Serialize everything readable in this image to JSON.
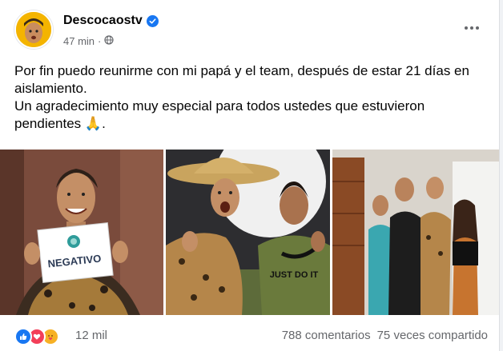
{
  "post": {
    "author": "Descocaostv",
    "time": "47 min",
    "text_lines": [
      "Por fin puedo reunirme con mi papá y el team, después de estar 21 días en aislamiento.",
      "Un agradecimiento muy especial para todos ustedes que estuvieron pendientes"
    ],
    "text_emoji": "🙏",
    "text_end": "."
  },
  "photos": {
    "sign_text": "NEGATIVO",
    "shirt_text": "JUST DO IT"
  },
  "footer": {
    "reaction_count": "12 mil",
    "comments": "788 comentarios",
    "shares": "75 veces compartido"
  },
  "colors": {
    "accent": "#1877f2",
    "like": "#1877f2",
    "love": "#f33e58",
    "care": "#f7b125"
  },
  "icons": [
    "verified-badge-icon",
    "globe-icon",
    "more-options-icon",
    "like-reaction-icon",
    "love-reaction-icon",
    "care-reaction-icon"
  ]
}
